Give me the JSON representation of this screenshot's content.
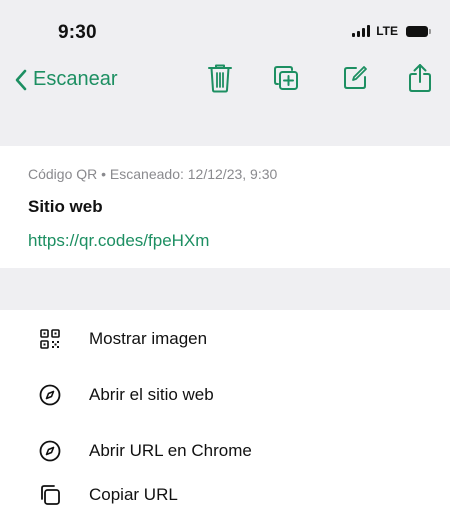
{
  "status_bar": {
    "time": "9:30",
    "network": "LTE"
  },
  "nav": {
    "back_label": "Escanear",
    "accent_color": "#1d8f62",
    "icons": [
      "trash-icon",
      "duplicate-icon",
      "edit-icon",
      "share-icon"
    ]
  },
  "scan": {
    "meta": "Código QR • Escaneado: 12/12/23, 9:30",
    "title": "Sitio web",
    "url": "https://qr.codes/fpeHXm"
  },
  "actions": [
    {
      "label": "Mostrar imagen",
      "icon": "qr-code-icon"
    },
    {
      "label": "Abrir el sitio web",
      "icon": "compass-icon"
    },
    {
      "label": "Abrir URL en Chrome",
      "icon": "compass-icon"
    },
    {
      "label": "Copiar URL",
      "icon": "copy-icon"
    }
  ]
}
